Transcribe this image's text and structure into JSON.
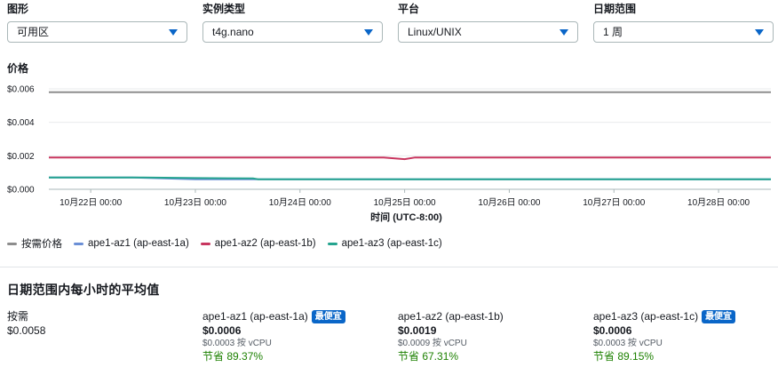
{
  "filters": [
    {
      "label": "图形",
      "value": "可用区"
    },
    {
      "label": "实例类型",
      "value": "t4g.nano"
    },
    {
      "label": "平台",
      "value": "Linux/UNIX"
    },
    {
      "label": "日期范围",
      "value": "1 周"
    }
  ],
  "chart_title": "价格",
  "colors": {
    "on_demand": "#8d8d8d",
    "az1": "#6b8fd6",
    "az2": "#c8365f",
    "az3": "#25a48f",
    "badge": "#0a66c8",
    "savings": "#1d8102"
  },
  "chart_data": {
    "type": "line",
    "x_title": "时间 (UTC-8:00)",
    "x_ticks": [
      "10月22日 00:00",
      "10月23日 00:00",
      "10月24日 00:00",
      "10月25日 00:00",
      "10月26日 00:00",
      "10月27日 00:00",
      "10月28日 00:00"
    ],
    "y_ticks": [
      "$0.000",
      "$0.002",
      "$0.004",
      "$0.006"
    ],
    "ylim": [
      0,
      0.006
    ],
    "x_range": [
      21.6,
      28.5
    ],
    "grid": true,
    "series": [
      {
        "name": "按需价格",
        "x": [
          21.6,
          28.5
        ],
        "y": [
          0.0058,
          0.0058
        ]
      },
      {
        "name": "ape1-az1 (ap-east-1a)",
        "x": [
          21.6,
          22.4,
          23.0,
          23.5,
          23.6,
          28.5
        ],
        "y": [
          0.0007,
          0.0007,
          0.0006,
          0.0006,
          0.0006,
          0.0006
        ]
      },
      {
        "name": "ape1-az2 (ap-east-1b)",
        "x": [
          21.6,
          24.8,
          25.0,
          25.1,
          28.5
        ],
        "y": [
          0.0019,
          0.0019,
          0.0018,
          0.0019,
          0.0019
        ]
      },
      {
        "name": "ape1-az3 (ap-east-1c)",
        "x": [
          21.6,
          22.5,
          23.0,
          23.55,
          23.6,
          28.5
        ],
        "y": [
          0.0007,
          0.0007,
          0.00067,
          0.00065,
          0.0006,
          0.0006
        ]
      }
    ]
  },
  "legend": [
    {
      "label": "按需价格"
    },
    {
      "label": "ape1-az1 (ap-east-1a)"
    },
    {
      "label": "ape1-az2 (ap-east-1b)"
    },
    {
      "label": "ape1-az3 (ap-east-1c)"
    }
  ],
  "summary": {
    "title": "日期范围内每小时的平均值",
    "on_demand": {
      "label": "按需",
      "value": "$0.0058"
    },
    "zones": [
      {
        "label": "ape1-az1 (ap-east-1a)",
        "badge": "最便宜",
        "price": "$0.0006",
        "vcpu": "$0.0003 按 vCPU",
        "savings": "节省 89.37%"
      },
      {
        "label": "ape1-az2 (ap-east-1b)",
        "badge": "",
        "price": "$0.0019",
        "vcpu": "$0.0009 按 vCPU",
        "savings": "节省 67.31%"
      },
      {
        "label": "ape1-az3 (ap-east-1c)",
        "badge": "最便宜",
        "price": "$0.0006",
        "vcpu": "$0.0003 按 vCPU",
        "savings": "节省 89.15%"
      }
    ]
  }
}
